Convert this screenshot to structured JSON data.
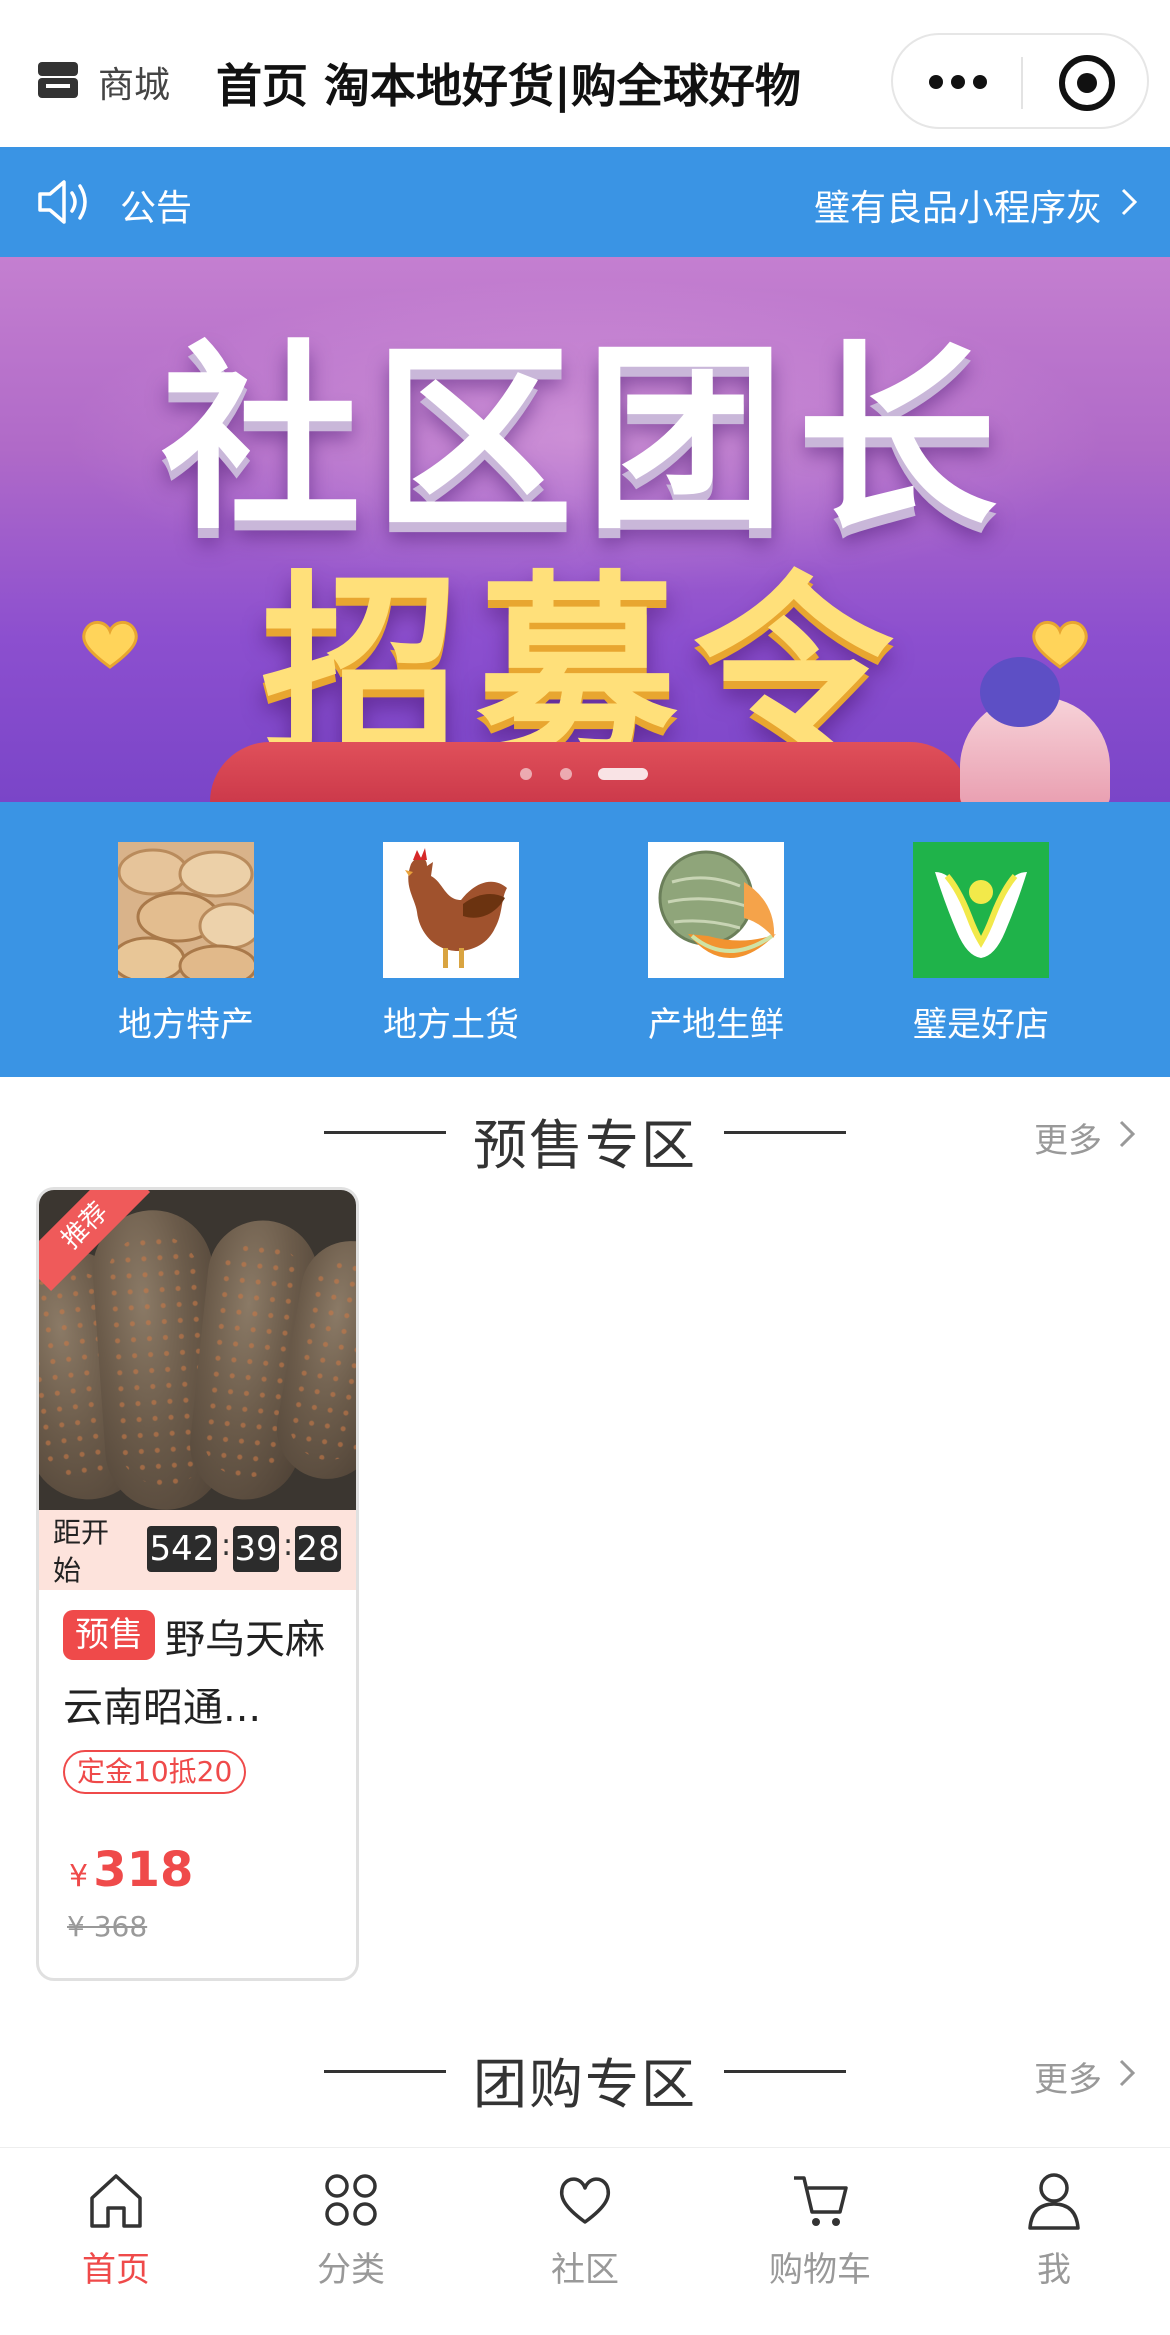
{
  "nav": {
    "shop_label": "商城",
    "title": "首页 淘本地好货|购全球好物",
    "more_icon": "more-dots-icon",
    "close_icon": "target-circle-icon"
  },
  "notice": {
    "label": "公告",
    "text": "璧有良品小程序灰",
    "icon": "speaker-icon"
  },
  "banner": {
    "line1": "社区团长",
    "line2": "招募令",
    "slide_count": 3,
    "active_slide": 3
  },
  "categories": [
    {
      "label": "地方特产",
      "icon": "dried-food-icon"
    },
    {
      "label": "地方土货",
      "icon": "rooster-icon"
    },
    {
      "label": "产地生鲜",
      "icon": "melon-icon"
    },
    {
      "label": "璧是好店",
      "icon": "v-logo-icon"
    }
  ],
  "presale": {
    "title": "预售专区",
    "more": "更多",
    "product": {
      "tag": "推荐",
      "countdown_label": "距开始",
      "countdown": [
        "542",
        "39",
        "28"
      ],
      "badge": "预售",
      "name": "野乌天麻云南昭通...",
      "deposit": "定金10抵20",
      "price_symbol": "¥",
      "price": "318",
      "original_price": "¥ 368"
    }
  },
  "group": {
    "title": "团购专区",
    "more": "更多"
  },
  "tabbar": [
    {
      "label": "首页",
      "icon": "home-icon",
      "active": true
    },
    {
      "label": "分类",
      "icon": "category-icon",
      "active": false
    },
    {
      "label": "社区",
      "icon": "heart-icon",
      "active": false
    },
    {
      "label": "购物车",
      "icon": "cart-icon",
      "active": false
    },
    {
      "label": "我",
      "icon": "user-icon",
      "active": false
    }
  ],
  "colors": {
    "accent": "#3a94e4",
    "price": "#ef4a4a"
  }
}
